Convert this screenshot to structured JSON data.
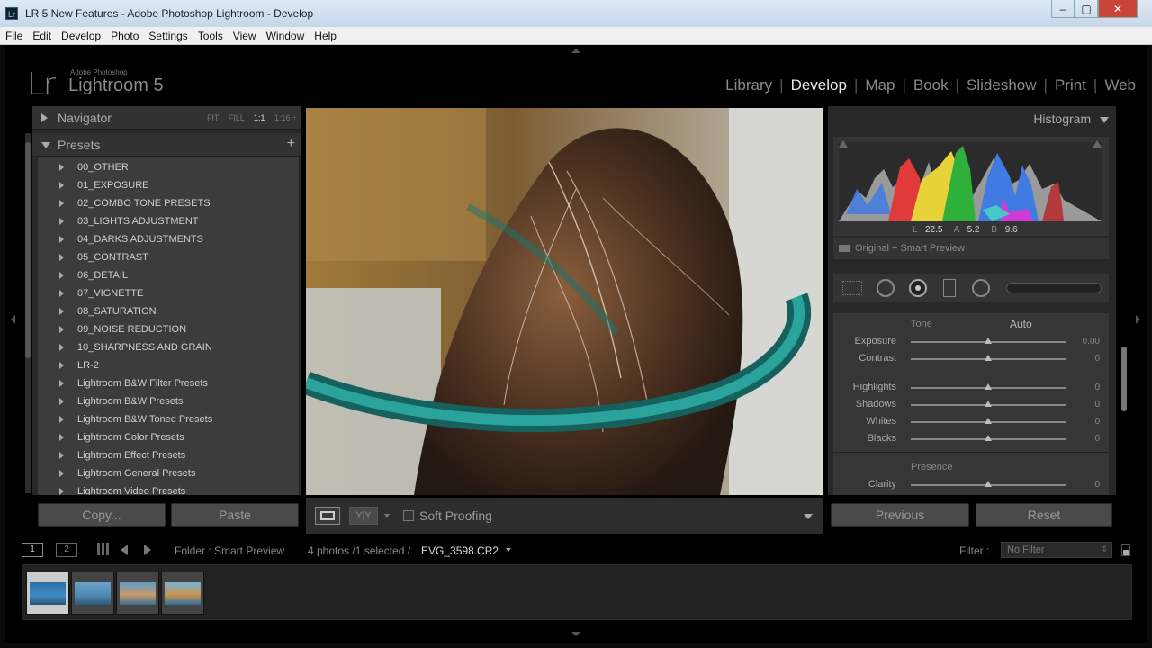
{
  "titlebar": {
    "title": "LR 5 New Features - Adobe Photoshop Lightroom - Develop",
    "app_icon": "Lr",
    "min": "–",
    "max": "▢",
    "close": "✕"
  },
  "menubar": {
    "items": [
      "File",
      "Edit",
      "Develop",
      "Photo",
      "Settings",
      "Tools",
      "View",
      "Window",
      "Help"
    ]
  },
  "brand": {
    "logo": "Lr",
    "adobe": "Adobe Photoshop",
    "name": "Lightroom 5"
  },
  "modules": {
    "items": [
      "Library",
      "Develop",
      "Map",
      "Book",
      "Slideshow",
      "Print",
      "Web"
    ],
    "active": "Develop"
  },
  "navigator": {
    "title": "Navigator",
    "options": [
      "FIT",
      "FILL",
      "1:1",
      "1:16 ÷"
    ],
    "selected": "1:1"
  },
  "presets": {
    "title": "Presets",
    "add": "+",
    "items": [
      "00_OTHER",
      "01_EXPOSURE",
      "02_COMBO TONE PRESETS",
      "03_LIGHTS ADJUSTMENT",
      "04_DARKS ADJUSTMENTS",
      "05_CONTRAST",
      "06_DETAIL",
      "07_VIGNETTE",
      "08_SATURATION",
      "09_NOISE REDUCTION",
      "10_SHARPNESS AND GRAIN",
      "LR-2",
      "Lightroom B&W Filter Presets",
      "Lightroom B&W Presets",
      "Lightroom B&W Toned Presets",
      "Lightroom Color Presets",
      "Lightroom Effect Presets",
      "Lightroom General Presets",
      "Lightroom Video Presets"
    ]
  },
  "left_buttons": {
    "copy": "Copy...",
    "paste": "Paste"
  },
  "toolbar": {
    "soft_proofing": "Soft Proofing",
    "view_compare": "Y|Y"
  },
  "histogram": {
    "title": "Histogram",
    "readout": {
      "l_label": "L",
      "l": "22.5",
      "a_label": "A",
      "a": "5.2",
      "b_label": "B",
      "b": "9.6"
    },
    "source": "Original + Smart Preview"
  },
  "basic": {
    "tone_label": "Tone",
    "auto": "Auto",
    "presence_label": "Presence",
    "sliders": [
      {
        "label": "Exposure",
        "value": "0.00"
      },
      {
        "label": "Contrast",
        "value": "0"
      },
      {
        "label": "Highlights",
        "value": "0"
      },
      {
        "label": "Shadows",
        "value": "0"
      },
      {
        "label": "Whites",
        "value": "0"
      },
      {
        "label": "Blacks",
        "value": "0"
      },
      {
        "label": "Clarity",
        "value": "0"
      }
    ]
  },
  "right_buttons": {
    "previous": "Previous",
    "reset": "Reset"
  },
  "filmstrip_bar": {
    "view1": "1",
    "view2": "2",
    "source": "Folder : Smart Preview",
    "count": "4 photos /1 selected /",
    "filename": "EVG_3598.CR2",
    "filter_label": "Filter :",
    "filter_value": "No Filter"
  },
  "colors": {
    "accent": "#e8e8e8",
    "panel": "#282828",
    "teal": "#1e8a86"
  }
}
